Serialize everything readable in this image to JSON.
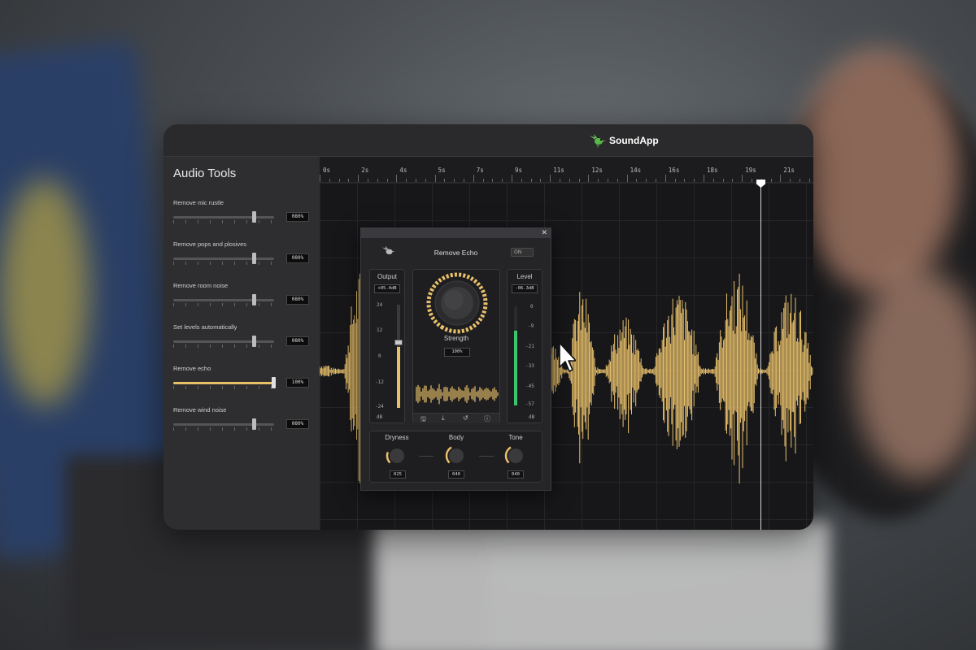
{
  "app": {
    "name": "SoundApp"
  },
  "sidebar": {
    "title": "Audio Tools",
    "tools": [
      {
        "label": "Remove mic rustle",
        "value_text": "080%",
        "level": 0.8,
        "active": false
      },
      {
        "label": "Remove pops and plosives",
        "value_text": "080%",
        "level": 0.8,
        "active": false
      },
      {
        "label": "Remove room noise",
        "value_text": "080%",
        "level": 0.8,
        "active": false
      },
      {
        "label": "Set levels automatically",
        "value_text": "080%",
        "level": 0.8,
        "active": false
      },
      {
        "label": "Remove echo",
        "value_text": "100%",
        "level": 1.0,
        "active": true
      },
      {
        "label": "Remove wind noise",
        "value_text": "080%",
        "level": 0.8,
        "active": false
      }
    ]
  },
  "timeline": {
    "ticks": [
      "0s",
      "2s",
      "4s",
      "5s",
      "7s",
      "9s",
      "11s",
      "12s",
      "14s",
      "16s",
      "18s",
      "19s",
      "21s"
    ],
    "playhead_time": "19.6s"
  },
  "plugin": {
    "title": "Remove Echo",
    "toggle": "ON",
    "output": {
      "label": "Output",
      "readout": "+05.4dB",
      "scale": [
        "24",
        "12",
        "0",
        "-12",
        "-24"
      ],
      "unit": "dB",
      "level": 0.42
    },
    "strength": {
      "label": "Strength",
      "readout": "100%"
    },
    "level": {
      "label": "Level",
      "readout": "-06.3dB",
      "scale": [
        "0",
        "-9",
        "-21",
        "-33",
        "-45",
        "-57"
      ],
      "unit": "dB",
      "meter": 0.75
    },
    "knobs": [
      {
        "label": "Dryness",
        "readout": "025"
      },
      {
        "label": "Body",
        "readout": "040"
      },
      {
        "label": "Tone",
        "readout": "040"
      }
    ]
  },
  "colors": {
    "accent": "#e8c06a",
    "meter": "#3ec46a",
    "background": "#17171a"
  },
  "icons": [
    "hummingbird-logo-icon",
    "close-icon",
    "save-icon",
    "download-icon",
    "reset-icon",
    "info-icon",
    "cursor-arrow-icon"
  ]
}
